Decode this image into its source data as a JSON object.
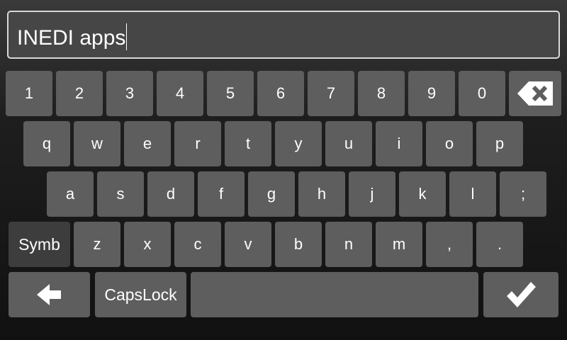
{
  "input": {
    "value": "INEDI apps"
  },
  "keyboard": {
    "row_numbers": [
      "1",
      "2",
      "3",
      "4",
      "5",
      "6",
      "7",
      "8",
      "9",
      "0"
    ],
    "row_top": [
      "q",
      "w",
      "e",
      "r",
      "t",
      "y",
      "u",
      "i",
      "o",
      "p"
    ],
    "row_home": [
      "a",
      "s",
      "d",
      "f",
      "g",
      "h",
      "j",
      "k",
      "l",
      ";"
    ],
    "row_bottom": [
      "z",
      "x",
      "c",
      "v",
      "b",
      "n",
      "m",
      ",",
      "."
    ],
    "symb_label": "Symb",
    "capslock_label": "CapsLock",
    "backspace_icon": "backspace-icon",
    "back_arrow_icon": "arrow-left-icon",
    "confirm_icon": "checkmark-icon"
  },
  "colors": {
    "key": "#5e5e5e",
    "key_dark": "#3d3d3d",
    "text": "#ffffff",
    "input_border": "#d8d8d8"
  }
}
